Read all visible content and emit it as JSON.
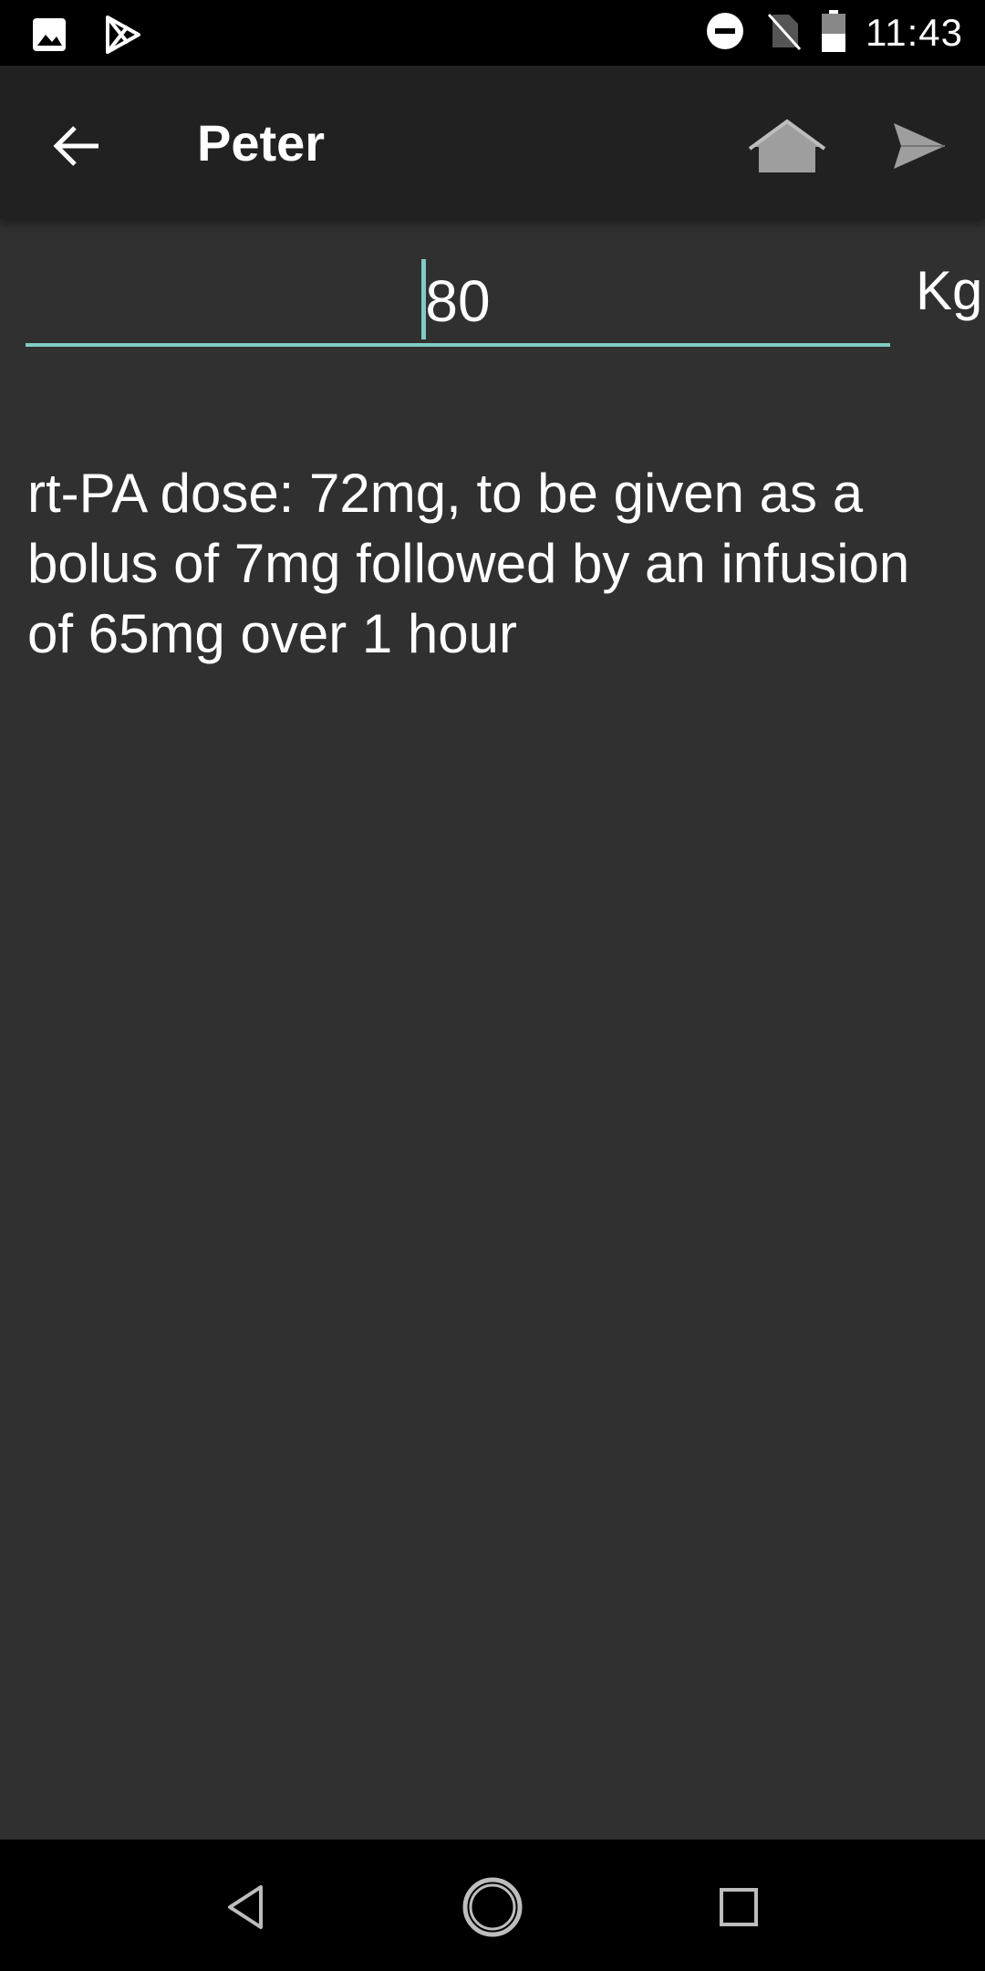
{
  "status_bar": {
    "time": "11:43",
    "left_icons": [
      "image-icon",
      "play-store-icon"
    ],
    "right_icons": [
      "do-not-disturb-icon",
      "no-sim-icon",
      "battery-icon"
    ]
  },
  "app_bar": {
    "title": "Peter",
    "icons": [
      "back-arrow-icon",
      "home-icon",
      "send-icon"
    ]
  },
  "weight": {
    "value": "80",
    "unit": "Kg"
  },
  "result": {
    "text": "rt-PA dose: 72mg, to be given as a bolus of 7mg followed by an infusion of 65mg over 1 hour"
  },
  "nav_bar": {
    "icons": [
      "nav-back-icon",
      "nav-home-icon",
      "nav-recents-icon"
    ]
  },
  "colors": {
    "background": "#303030",
    "app_bar": "#212121",
    "accent": "#80cbc4"
  }
}
